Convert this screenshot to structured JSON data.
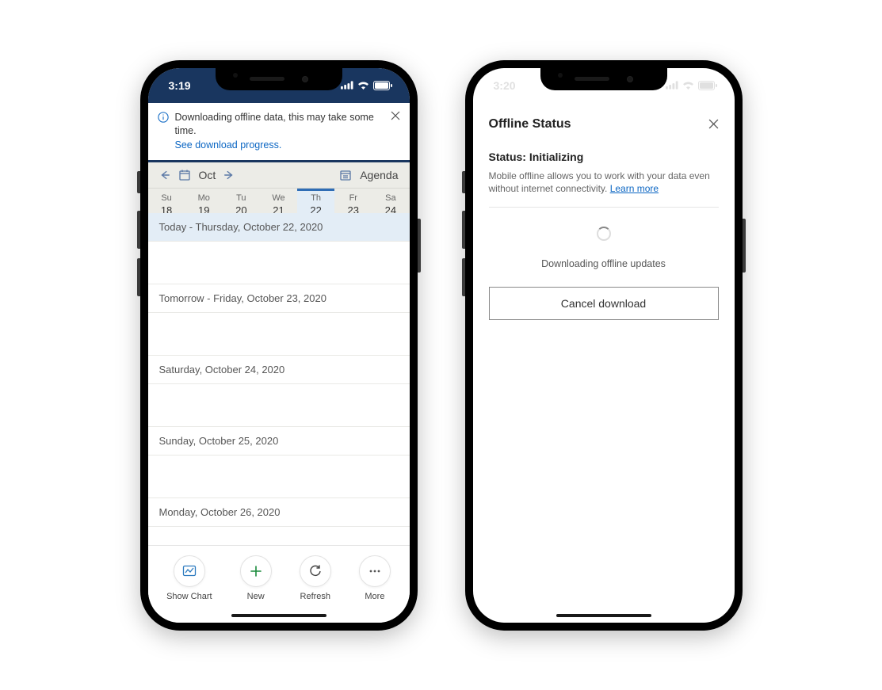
{
  "phoneA": {
    "time": "3:19",
    "banner": {
      "msg": "Downloading offline data, this may take some time.",
      "link": "See download progress."
    },
    "calbar": {
      "month": "Oct",
      "agenda": "Agenda"
    },
    "week": [
      {
        "dow": "Su",
        "num": "18"
      },
      {
        "dow": "Mo",
        "num": "19"
      },
      {
        "dow": "Tu",
        "num": "20"
      },
      {
        "dow": "We",
        "num": "21"
      },
      {
        "dow": "Th",
        "num": "22",
        "selected": true
      },
      {
        "dow": "Fr",
        "num": "23"
      },
      {
        "dow": "Sa",
        "num": "24"
      }
    ],
    "agenda": [
      {
        "label": "Today - Thursday, October 22, 2020",
        "today": true
      },
      {
        "label": "Tomorrow - Friday, October 23, 2020"
      },
      {
        "label": "Saturday, October 24, 2020"
      },
      {
        "label": "Sunday, October 25, 2020"
      },
      {
        "label": "Monday, October 26, 2020"
      }
    ],
    "bottom": {
      "showChart": "Show Chart",
      "new": "New",
      "refresh": "Refresh",
      "more": "More"
    }
  },
  "phoneB": {
    "time": "3:20",
    "title": "Offline Status",
    "status": "Status: Initializing",
    "desc": "Mobile offline allows you to work with your data even without internet connectivity. ",
    "learn": "Learn more",
    "downloading": "Downloading offline updates",
    "cancel": "Cancel download"
  }
}
